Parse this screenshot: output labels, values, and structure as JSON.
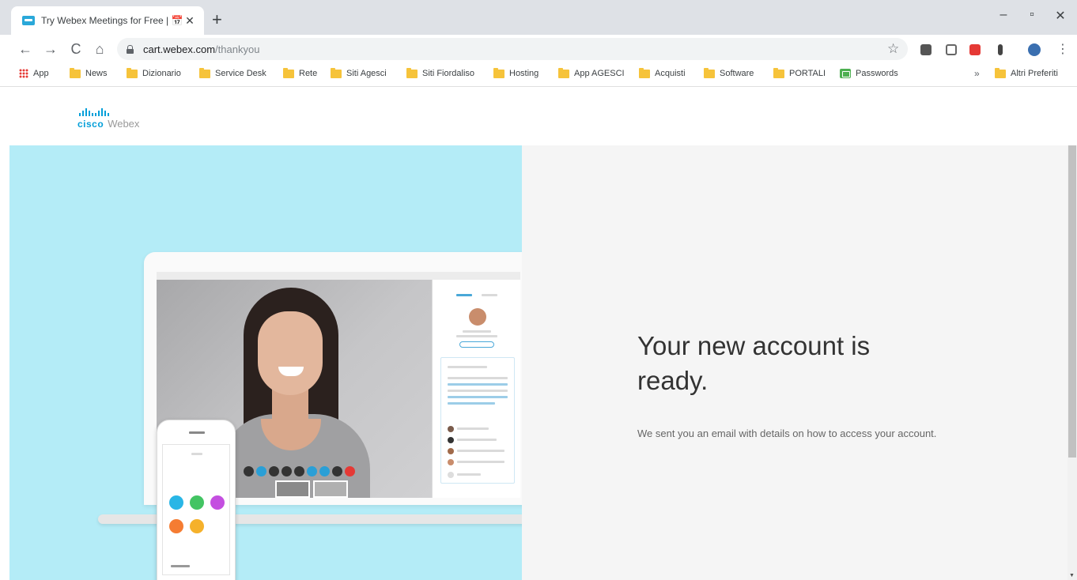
{
  "browser": {
    "tab_title": "Try Webex Meetings for Free | 📅 ",
    "tab_close": "✕",
    "new_tab": "+",
    "minimize": "–",
    "maximize": "▫",
    "close": "✕",
    "back": "←",
    "forward": "→",
    "reload": "C",
    "home": "⌂",
    "url_host": "cart.webex.com",
    "url_path": "/thankyou",
    "star": "☆",
    "menu": "⋮",
    "more_bookmarks": "»"
  },
  "bookmarks": [
    {
      "label": "App",
      "icon": "apps-icon"
    },
    {
      "label": "News",
      "icon": "folder-icon"
    },
    {
      "label": "Dizionario",
      "icon": "folder-icon"
    },
    {
      "label": "Service Desk",
      "icon": "folder-icon"
    },
    {
      "label": "Rete",
      "icon": "folder-icon"
    },
    {
      "label": "Siti Agesci",
      "icon": "folder-icon"
    },
    {
      "label": "Siti Fiordaliso",
      "icon": "folder-icon"
    },
    {
      "label": "Hosting",
      "icon": "folder-icon"
    },
    {
      "label": "App AGESCI",
      "icon": "folder-icon"
    },
    {
      "label": "Acquisti",
      "icon": "folder-icon"
    },
    {
      "label": "Software",
      "icon": "folder-icon"
    },
    {
      "label": "PORTALI",
      "icon": "folder-icon"
    },
    {
      "label": "Passwords",
      "icon": "password-icon"
    },
    {
      "label": "Altri Preferiti",
      "icon": "folder-icon"
    }
  ],
  "page": {
    "logo_cisco": "cisco",
    "logo_webex": "Webex",
    "title": "Your new account is ready.",
    "subtitle": "We sent you an email with details on how to access your account."
  },
  "colors": {
    "hero_left_bg": "#b4ecf7",
    "hero_right_bg": "#f5f5f5",
    "cisco_blue": "#049fd9"
  }
}
